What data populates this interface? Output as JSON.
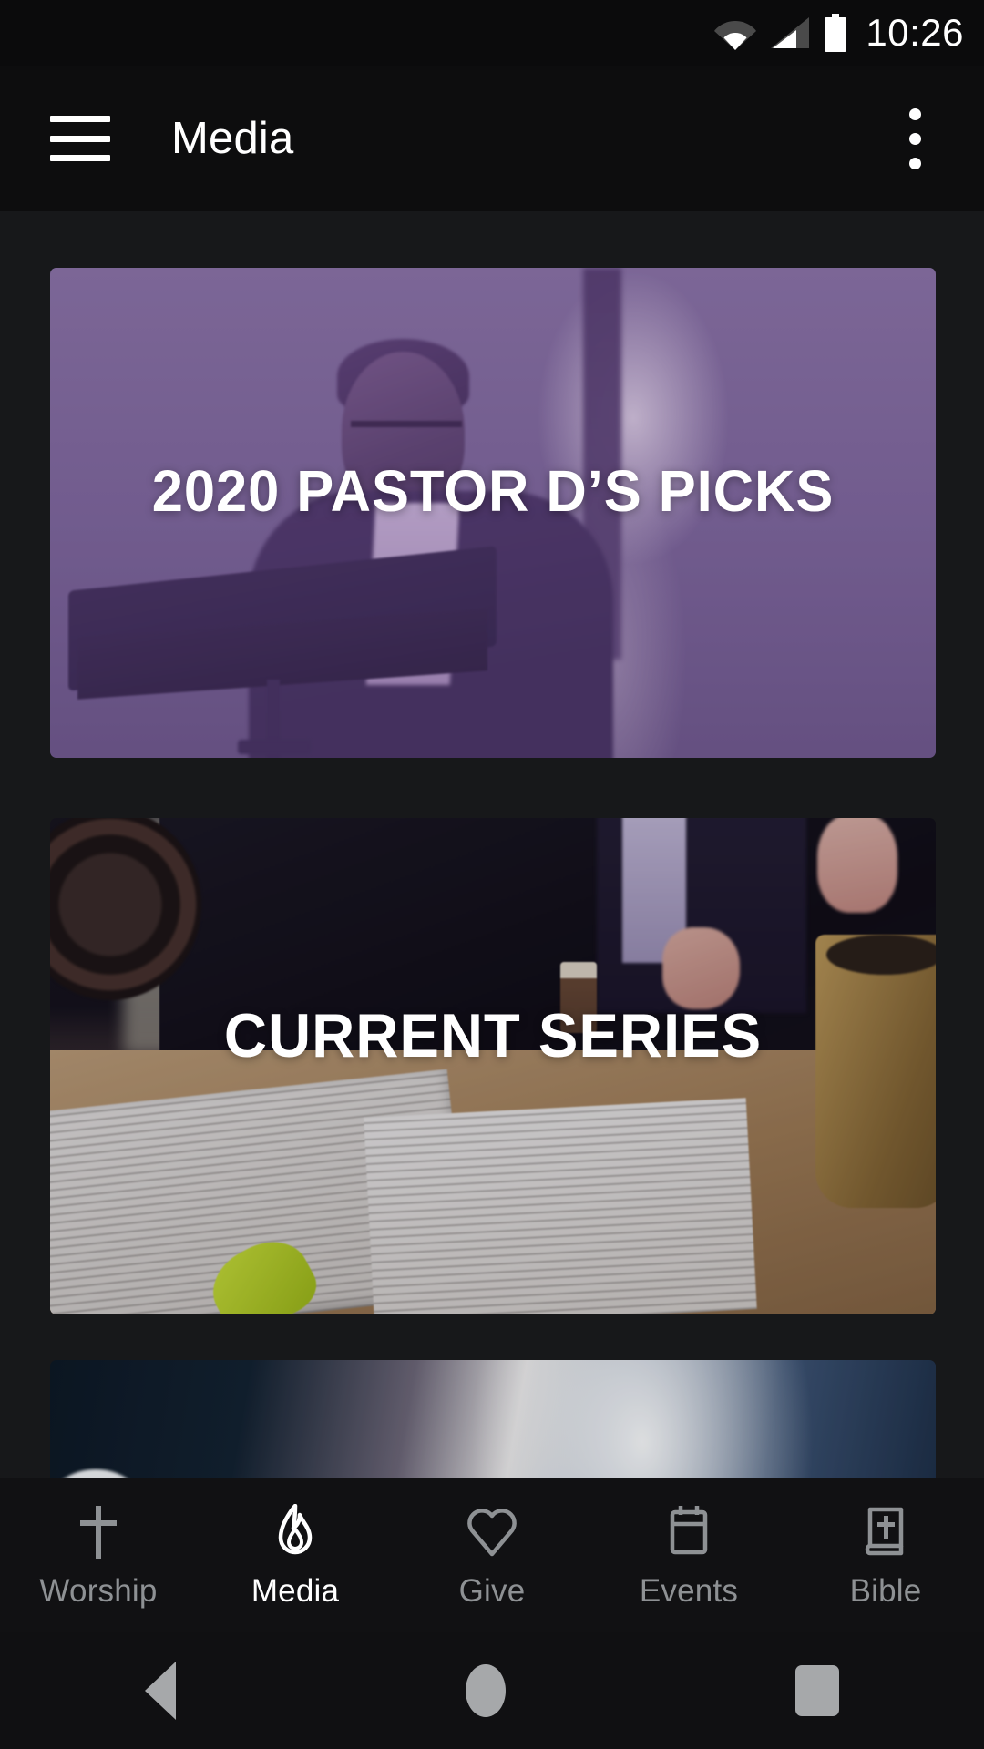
{
  "statusbar": {
    "clock": "10:26",
    "icons": [
      "wifi-icon",
      "cellular-signal-icon",
      "battery-icon"
    ]
  },
  "appbar": {
    "menu_icon": "hamburger-menu-icon",
    "title": "Media",
    "overflow_icon": "overflow-menu-icon"
  },
  "media_cards": [
    {
      "title": "2020 PASTOR D’S PICKS",
      "overlay_color": "#7852a0",
      "name": "media-card-pastor-picks"
    },
    {
      "title": "CURRENT SERIES",
      "overlay_color": "#120c1a",
      "name": "media-card-current-series"
    },
    {
      "title": "",
      "overlay_color": "#0a0e16",
      "name": "media-card-third"
    }
  ],
  "tabbar": {
    "active_color": "#ffffff",
    "inactive_color": "#8e9194",
    "items": [
      {
        "label": "Worship",
        "icon": "cross-icon",
        "active": false
      },
      {
        "label": "Media",
        "icon": "flame-icon",
        "active": true
      },
      {
        "label": "Give",
        "icon": "heart-icon",
        "active": false
      },
      {
        "label": "Events",
        "icon": "calendar-icon",
        "active": false
      },
      {
        "label": "Bible",
        "icon": "bible-book-icon",
        "active": false
      }
    ]
  },
  "androidnav": {
    "back": "back-triangle-icon",
    "home": "home-circle-icon",
    "recents": "recents-square-icon"
  }
}
